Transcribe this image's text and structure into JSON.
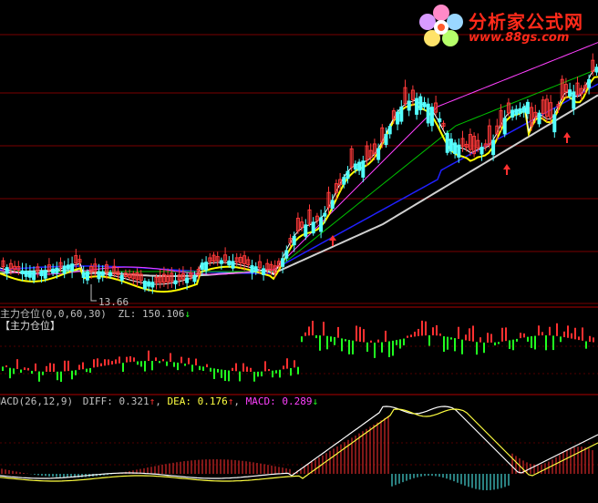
{
  "colors": {
    "background": "#000000",
    "grid": "#7a0000",
    "panel_divider": "#b00000",
    "candle_up": "#ff3a3a",
    "candle_down": "#54ffff",
    "ma5": "#ffffff",
    "ma10": "#ffff00",
    "ma20": "#ff40ff",
    "ma30": "#00c000",
    "ma60": "#d0d0d0",
    "ma120": "#2020ff",
    "bar_up": "#ff3030",
    "bar_down": "#20ff20",
    "label_text": "#c0c0c0",
    "diff_color": "#ff3030",
    "dea_color": "#ffff40",
    "macd_color": "#ff40ff",
    "logo_red": "#ff2a1a"
  },
  "logo": {
    "icon": "flower-logo-icon",
    "title": "分析家公式网",
    "url": "www.88gs.com"
  },
  "price_panel": {
    "low_marker": "13.66"
  },
  "zl_panel": {
    "name": "主力仓位",
    "params": "(0,0,60,30)",
    "zl_label": "ZL: ",
    "zl_value": "150.106",
    "zl_arrow": "↓",
    "sub_label": "【主力仓位】"
  },
  "macd_panel": {
    "name": "MACD",
    "params": "(26,12,9)",
    "diff_label": "DIFF: ",
    "diff_value": "0.321",
    "diff_arrow": "↑",
    "dea_label": "DEA: ",
    "dea_value": "0.176",
    "dea_arrow": "↑",
    "macd_label": "MACD: ",
    "macd_value": "0.289",
    "macd_arrow": "↓"
  }
}
